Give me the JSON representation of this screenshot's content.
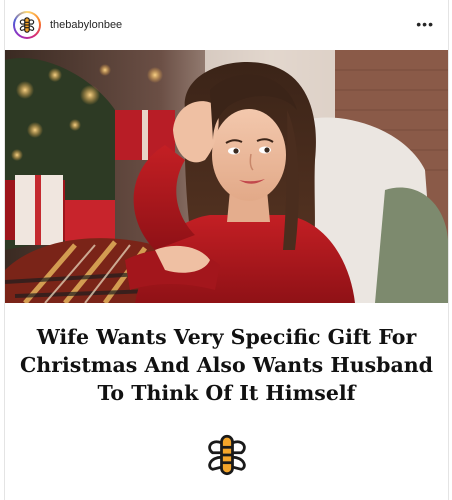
{
  "post": {
    "username": "thebabylonbee",
    "more_label": "•••",
    "headline_lines": [
      "Wife Wants Very Specific Gift For",
      "Christmas And Also Wants Husband",
      "To Think Of It Himself"
    ]
  },
  "icons": {
    "avatar": "babylon-bee-logo-icon",
    "more": "more-options-icon",
    "footer_logo": "babylon-bee-logo-icon"
  },
  "colors": {
    "bee_orange": "#f4a52a",
    "bee_black": "#1a1a1a",
    "sweater_red": "#b3191f"
  }
}
